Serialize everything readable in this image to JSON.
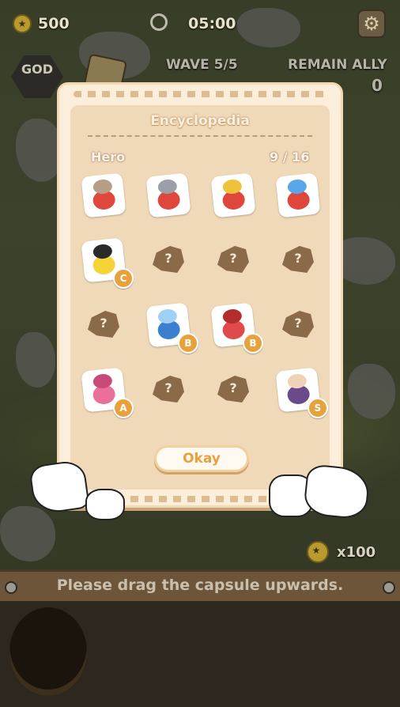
{
  "topbar": {
    "coins": "500",
    "timer": "05:00",
    "wave": "WAVE 5/5",
    "remain_ally_label": "REMAIN ALLY",
    "remain_ally_count": "0"
  },
  "god_label": "GOD",
  "encyclopedia": {
    "title": "Encyclopedia",
    "category": "Hero",
    "progress": "9 / 16",
    "unknown_glyph": "?",
    "slots": [
      {
        "state": "unlocked",
        "icon": "hero-sword-icon",
        "grade": ""
      },
      {
        "state": "unlocked",
        "icon": "hero-knight-icon",
        "grade": ""
      },
      {
        "state": "unlocked",
        "icon": "hero-shield-icon",
        "grade": ""
      },
      {
        "state": "unlocked",
        "icon": "hero-rainbow-icon",
        "grade": ""
      },
      {
        "state": "unlocked",
        "icon": "duck-tophat-icon",
        "grade": "C"
      },
      {
        "state": "locked",
        "icon": "unknown-icon",
        "grade": ""
      },
      {
        "state": "locked",
        "icon": "unknown-icon",
        "grade": ""
      },
      {
        "state": "locked",
        "icon": "unknown-icon",
        "grade": ""
      },
      {
        "state": "locked",
        "icon": "unknown-icon",
        "grade": ""
      },
      {
        "state": "unlocked",
        "icon": "blue-fish-icon",
        "grade": "B"
      },
      {
        "state": "unlocked",
        "icon": "red-octopus-icon",
        "grade": "B"
      },
      {
        "state": "locked",
        "icon": "unknown-icon",
        "grade": ""
      },
      {
        "state": "unlocked",
        "icon": "pink-dinosaur-icon",
        "grade": "A"
      },
      {
        "state": "locked",
        "icon": "unknown-icon",
        "grade": ""
      },
      {
        "state": "locked",
        "icon": "unknown-icon",
        "grade": ""
      },
      {
        "state": "unlocked",
        "icon": "schoolgirl-icon",
        "grade": "S"
      }
    ],
    "okay_label": "Okay"
  },
  "reward": "x100",
  "hint": "Please drag the capsule upwards.",
  "colors": {
    "accent": "#e9a23b",
    "panel": "#fbeedb",
    "inner": "#f0d9b8",
    "locked": "#8a6a48"
  }
}
